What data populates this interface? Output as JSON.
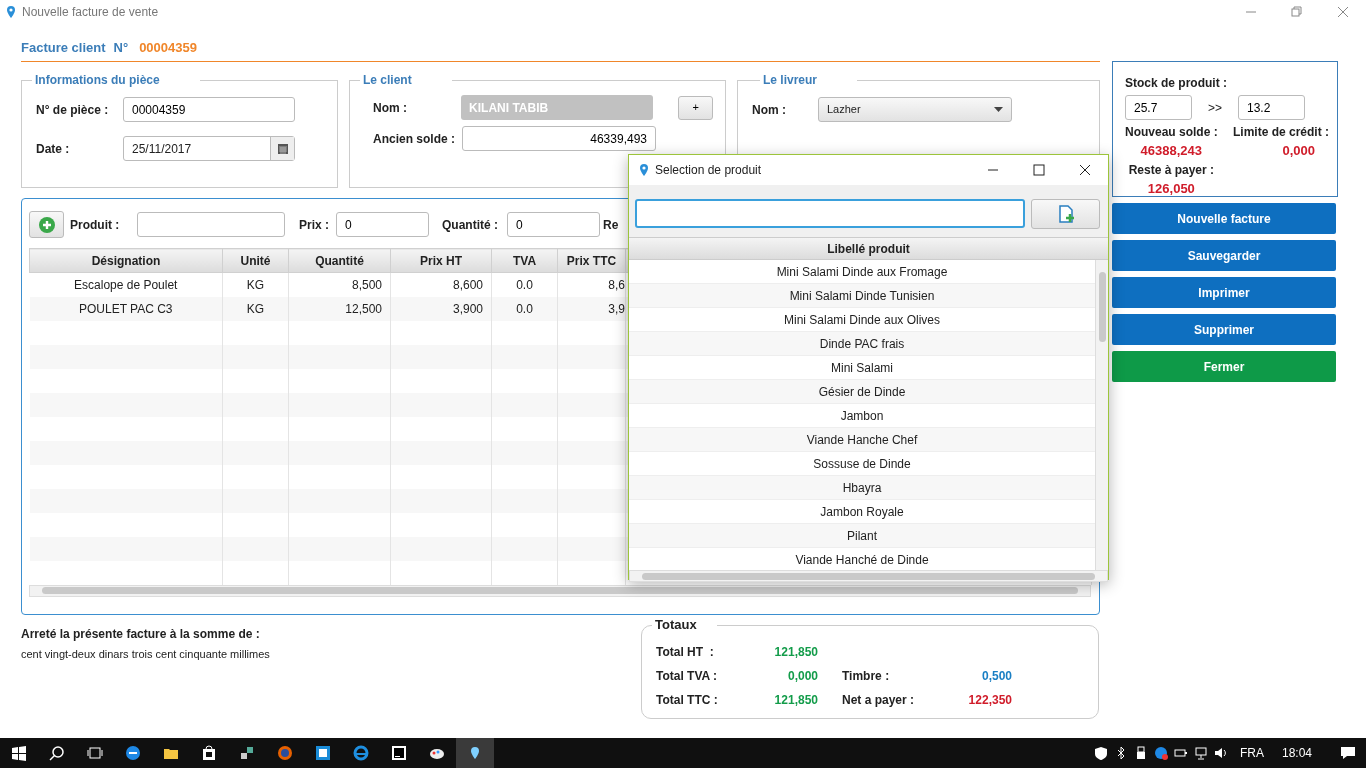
{
  "window": {
    "title": "Nouvelle facture de vente"
  },
  "header": {
    "label": "Facture client",
    "number_label": "N°",
    "number": "00004359"
  },
  "piece": {
    "legend": "Informations du pièce",
    "fields": [
      {
        "label": "N° de pièce :",
        "value": "00004359",
        "kind": "text"
      },
      {
        "label": "Date :",
        "value": "25/11/2017",
        "kind": "date"
      }
    ]
  },
  "client": {
    "legend": "Le client",
    "name_label": "Nom :",
    "name": "KILANI TABIB",
    "add_button": "+",
    "balance_label": "Ancien solde :",
    "balance": "46339,493"
  },
  "livreur": {
    "legend": "Le livreur",
    "name_label": "Nom :",
    "name": "Lazher"
  },
  "entry": {
    "fields": [
      {
        "label": "Produit :"
      },
      {
        "label": "Prix :",
        "value": "0"
      },
      {
        "label": "Quantité :",
        "value": "0"
      }
    ],
    "cut_label": "Re"
  },
  "table": {
    "columns": [
      "Désignation",
      "Unité",
      "Quantité",
      "Prix HT",
      "TVA",
      "Prix TTC"
    ],
    "rows": [
      [
        "Escalope de Poulet",
        "KG",
        "8,500",
        "8,600",
        "0.0",
        "8,6"
      ],
      [
        "POULET PAC C3",
        "KG",
        "12,500",
        "3,900",
        "0.0",
        "3,9"
      ]
    ]
  },
  "stock": {
    "label": "Stock de produit :",
    "from": "25.7",
    "arrow": ">>",
    "to": "13.2",
    "new_balance_label": "Nouveau solde :",
    "new_balance": "46388,243",
    "credit_label": "Limite de crédit :",
    "credit": "0,000",
    "rest_label": "Reste à payer :",
    "rest": "126,050"
  },
  "actions": [
    {
      "label": "Nouvelle facture",
      "kind": "primary"
    },
    {
      "label": "Sauvegarder",
      "kind": "primary"
    },
    {
      "label": "Imprimer",
      "kind": "primary"
    },
    {
      "label": "Supprimer",
      "kind": "primary"
    },
    {
      "label": "Fermer",
      "kind": "success"
    }
  ],
  "amount_words": {
    "label": "Arreté la présente facture à la somme de :",
    "text": "cent vingt-deux dinars trois cent cinquante millimes"
  },
  "totals": {
    "legend": "Totaux",
    "rows": [
      [
        {
          "label": "Total HT  :",
          "value": "121,850",
          "color": "#139c4a"
        }
      ],
      [
        {
          "label": "Total TVA :",
          "value": "0,000",
          "color": "#139c4a"
        },
        {
          "label": "Timbre :",
          "value": "0,500",
          "color": "#1a7fc4"
        }
      ],
      [
        {
          "label": "Total TTC :",
          "value": "121,850",
          "color": "#139c4a"
        },
        {
          "label": "Net a payer :",
          "value": "122,350",
          "color": "#d01c2a"
        }
      ]
    ]
  },
  "dialog": {
    "title": "Selection de produit",
    "column": "Libellé produit",
    "products": [
      "Mini Salami Dinde aux Fromage",
      "Mini Salami Dinde Tunisien",
      "Mini Salami Dinde aux Olives",
      "Dinde PAC frais",
      "Mini Salami",
      "Gésier de Dinde",
      "Jambon",
      "Viande Hanche Chef",
      "Sossuse de Dinde",
      "Hbayra",
      "Jambon Royale",
      "Pilant",
      "Viande Hanché de Dinde"
    ]
  },
  "taskbar": {
    "language": "FRA",
    "time": "18:04"
  }
}
